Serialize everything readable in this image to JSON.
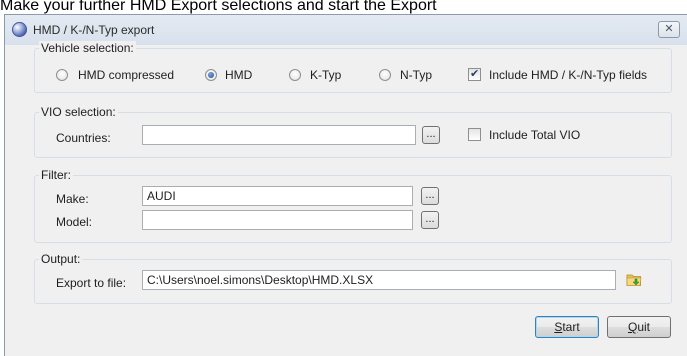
{
  "instruction": "Make your further HMD Export selections and start the Export",
  "window": {
    "title": "HMD / K-/N-Typ export",
    "close_label": "✕"
  },
  "vehicle_selection": {
    "title": "Vehicle selection:",
    "options": [
      {
        "label": "HMD compressed",
        "selected": false
      },
      {
        "label": "HMD",
        "selected": true
      },
      {
        "label": "K-Typ",
        "selected": false
      },
      {
        "label": "N-Typ",
        "selected": false
      }
    ],
    "include_fields": {
      "label": "Include HMD / K-/N-Typ fields",
      "checked": true
    }
  },
  "vio_selection": {
    "title": "VIO selection:",
    "countries_label": "Countries:",
    "countries_value": "",
    "browse_label": "...",
    "include_total": {
      "label": "Include Total VIO",
      "checked": false
    }
  },
  "filter": {
    "title": "Filter:",
    "make_label": "Make:",
    "make_value": "AUDI",
    "model_label": "Model:",
    "model_value": "",
    "browse_label": "..."
  },
  "output": {
    "title": "Output:",
    "export_label": "Export to file:",
    "export_value": "C:\\Users\\noel.simons\\Desktop\\HMD.XLSX"
  },
  "buttons": {
    "start_mnemonic": "S",
    "start_rest": "tart",
    "quit_mnemonic": "Q",
    "quit_rest": "uit"
  },
  "icons": {
    "app": "globe-icon",
    "folder": "open-folder-icon"
  }
}
